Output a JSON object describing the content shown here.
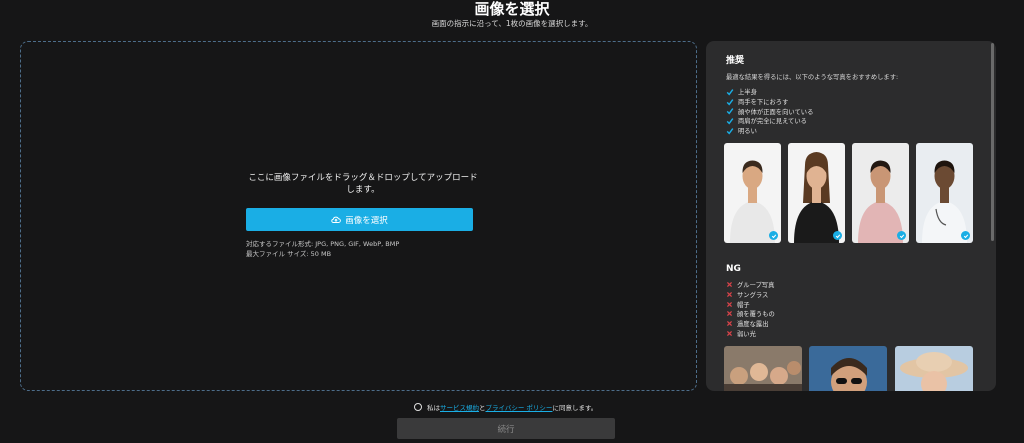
{
  "page": {
    "title": "画像を選択",
    "subtitle": "画面の指示に沿って、1枚の画像を選択します。"
  },
  "dropzone": {
    "text": "ここに画像ファイルをドラッグ＆ドロップしてアップロードします。",
    "button_label": "画像を選択",
    "formats": "対応するファイル形式: JPG, PNG, GIF, WebP, BMP",
    "max_size": "最大ファイル サイズ: 50 MB"
  },
  "recommend": {
    "title": "推奨",
    "intro": "最適な結果を得るには、以下のような写真をおすすめします:",
    "items": [
      "上半身",
      "両手を下におろす",
      "顔や体が正面を向いている",
      "両肩が完全に見えている",
      "明るい"
    ],
    "photos": [
      {
        "icon": "man-tshirt-photo",
        "shirt": "#e8e8e8",
        "skin": "#d9a882",
        "hair": "#3a2a1e",
        "bg": "#f4f4f4"
      },
      {
        "icon": "woman-black-top-photo",
        "shirt": "#1a1a1a",
        "skin": "#e0b392",
        "hair": "#5a3a22",
        "bg": "#f4f4f4"
      },
      {
        "icon": "woman-pink-top-photo",
        "shirt": "#e2b5b5",
        "skin": "#c99675",
        "hair": "#231812",
        "bg": "#ececec"
      },
      {
        "icon": "doctor-photo",
        "shirt": "#f4f6f8",
        "skin": "#6b4a33",
        "hair": "#1e140e",
        "bg": "#e9edf1"
      }
    ]
  },
  "ng": {
    "title": "NG",
    "items": [
      "グループ写真",
      "サングラス",
      "帽子",
      "顔を覆うもの",
      "過度な露出",
      "弱い光"
    ],
    "photos": [
      {
        "icon": "group-photo",
        "bg": "#8a7a6a"
      },
      {
        "icon": "sunglasses-photo",
        "bg": "#3a6a9a"
      },
      {
        "icon": "hat-photo",
        "bg": "#b8cde0"
      }
    ]
  },
  "agreement": {
    "prefix": "私は",
    "terms_link": "サービス規約",
    "conjunction": "と",
    "privacy_link": "プライバシー ポリシー",
    "suffix": "に同意します。"
  },
  "continue_label": "続行",
  "colors": {
    "accent": "#1aaee5",
    "background": "#161617",
    "panel": "#2c2c2d",
    "ng_red": "#d9434a"
  }
}
